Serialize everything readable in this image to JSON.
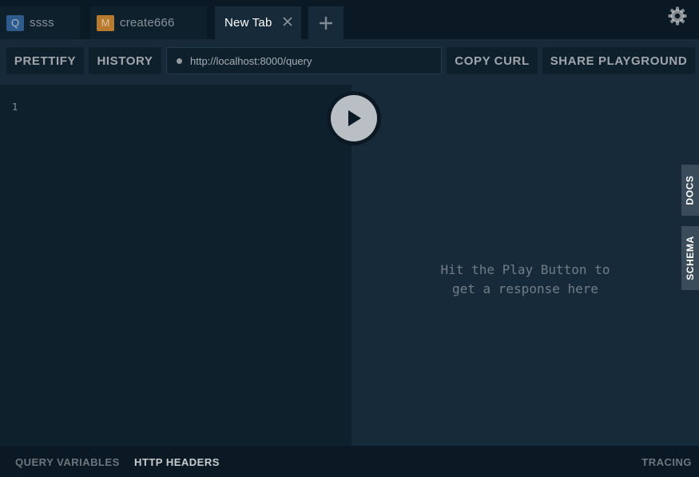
{
  "tabs": [
    {
      "badge": "Q",
      "badge_color": "#2e5a8c",
      "label": "ssss"
    },
    {
      "badge": "M",
      "badge_color": "#b87a2c",
      "label": "create666"
    },
    {
      "label": "New Tab",
      "active": true
    }
  ],
  "icons": {
    "add_tab": "plus-icon",
    "settings": "gear-icon",
    "close_tab": "close-icon",
    "play": "play-icon"
  },
  "toolbar": {
    "prettify_label": "PRETTIFY",
    "history_label": "HISTORY",
    "endpoint_url": "http://localhost:8000/query",
    "copy_curl_label": "COPY CURL",
    "share_label": "SHARE PLAYGROUND"
  },
  "editor": {
    "line_numbers": [
      "1"
    ]
  },
  "result": {
    "placeholder_line1": "Hit the Play Button to",
    "placeholder_line2": "get a response here"
  },
  "side_tabs": {
    "docs_label": "DOCS",
    "schema_label": "SCHEMA"
  },
  "bottom": {
    "query_variables_label": "QUERY VARIABLES",
    "http_headers_label": "HTTP HEADERS",
    "tracing_label": "TRACING"
  },
  "colors": {
    "background": "#0f202d",
    "panel": "#172a3a",
    "topbar": "#0b1924",
    "side_tab": "#3a4c5a"
  }
}
